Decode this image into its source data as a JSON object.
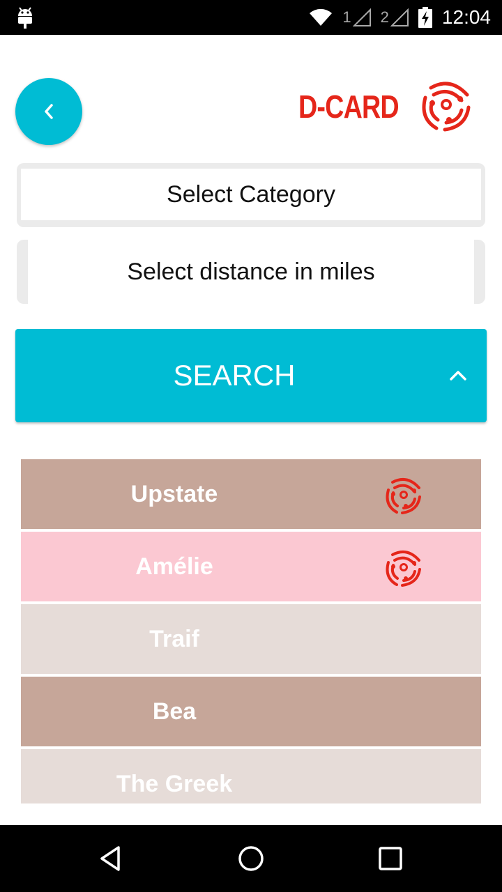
{
  "status_bar": {
    "sim1": "1",
    "sim2": "2",
    "time": "12:04",
    "icons": [
      "android-debug-icon",
      "wifi-icon",
      "signal-icon",
      "signal-icon",
      "battery-charging-icon"
    ]
  },
  "header": {
    "back_icon": "chevron-left-icon",
    "logo_text": "D-CARD"
  },
  "filters": {
    "category_label": "Select Category",
    "distance_label": "Select distance in miles"
  },
  "search": {
    "label": "SEARCH",
    "toggle_icon": "chevron-up-icon"
  },
  "results": [
    {
      "name": "Upstate",
      "color": "#c6a699",
      "has_badge": true
    },
    {
      "name": "Amélie",
      "color": "#fbc8d2",
      "has_badge": true
    },
    {
      "name": "Traif",
      "color": "#e6dcd8",
      "has_badge": false
    },
    {
      "name": "Bea",
      "color": "#c6a699",
      "has_badge": false
    },
    {
      "name": "The Greek",
      "color": "#e6dcd8",
      "has_badge": false
    }
  ],
  "colors": {
    "accent": "#00bcd4",
    "brand": "#e5261a"
  },
  "nav_bar": {
    "icons": [
      "back-triangle-icon",
      "home-circle-icon",
      "recents-square-icon"
    ]
  }
}
